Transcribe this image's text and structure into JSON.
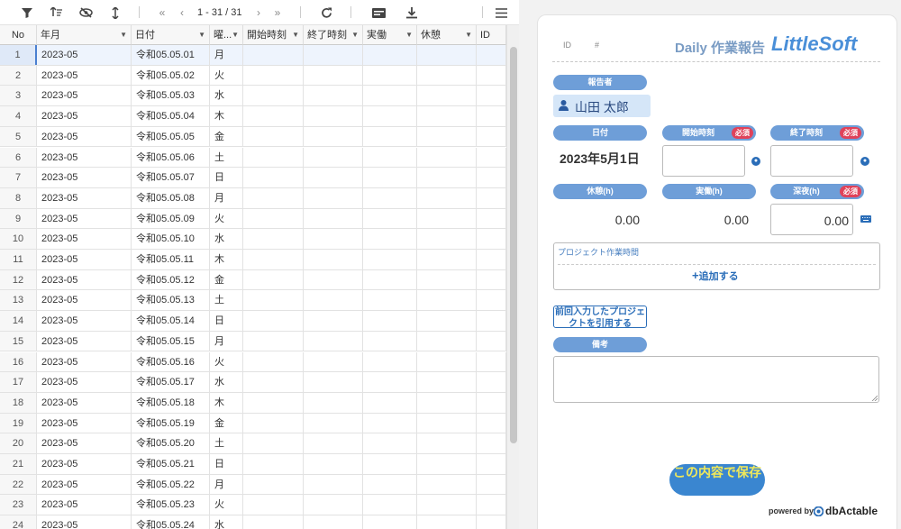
{
  "toolbar": {
    "page_indicator": "1 - 31 / 31"
  },
  "grid": {
    "columns": [
      "No",
      "年月",
      "日付",
      "曜...",
      "開始時刻",
      "終了時刻",
      "実働",
      "休憩",
      "ID"
    ],
    "rows": [
      [
        "1",
        "2023-05",
        "令和05.05.01",
        "月"
      ],
      [
        "2",
        "2023-05",
        "令和05.05.02",
        "火"
      ],
      [
        "3",
        "2023-05",
        "令和05.05.03",
        "水"
      ],
      [
        "4",
        "2023-05",
        "令和05.05.04",
        "木"
      ],
      [
        "5",
        "2023-05",
        "令和05.05.05",
        "金"
      ],
      [
        "6",
        "2023-05",
        "令和05.05.06",
        "土"
      ],
      [
        "7",
        "2023-05",
        "令和05.05.07",
        "日"
      ],
      [
        "8",
        "2023-05",
        "令和05.05.08",
        "月"
      ],
      [
        "9",
        "2023-05",
        "令和05.05.09",
        "火"
      ],
      [
        "10",
        "2023-05",
        "令和05.05.10",
        "水"
      ],
      [
        "11",
        "2023-05",
        "令和05.05.11",
        "木"
      ],
      [
        "12",
        "2023-05",
        "令和05.05.12",
        "金"
      ],
      [
        "13",
        "2023-05",
        "令和05.05.13",
        "土"
      ],
      [
        "14",
        "2023-05",
        "令和05.05.14",
        "日"
      ],
      [
        "15",
        "2023-05",
        "令和05.05.15",
        "月"
      ],
      [
        "16",
        "2023-05",
        "令和05.05.16",
        "火"
      ],
      [
        "17",
        "2023-05",
        "令和05.05.17",
        "水"
      ],
      [
        "18",
        "2023-05",
        "令和05.05.18",
        "木"
      ],
      [
        "19",
        "2023-05",
        "令和05.05.19",
        "金"
      ],
      [
        "20",
        "2023-05",
        "令和05.05.20",
        "土"
      ],
      [
        "21",
        "2023-05",
        "令和05.05.21",
        "日"
      ],
      [
        "22",
        "2023-05",
        "令和05.05.22",
        "月"
      ],
      [
        "23",
        "2023-05",
        "令和05.05.23",
        "火"
      ],
      [
        "24",
        "2023-05",
        "令和05.05.24",
        "水"
      ]
    ]
  },
  "form": {
    "id_label": "ID",
    "id_value": "#",
    "title": "Daily 作業報告",
    "brand": "LittleSoft",
    "reporter_label": "報告者",
    "reporter_name": "山田 太郎",
    "date_label": "日付",
    "date_value": "2023年5月1日",
    "start_label": "開始時刻",
    "end_label": "終了時刻",
    "required_badge": "必須",
    "break_label": "休憩(h)",
    "break_value": "0.00",
    "work_label": "実働(h)",
    "work_value": "0.00",
    "night_label": "深夜(h)",
    "night_value": "0.00",
    "project_section_label": "プロジェクト作業時間",
    "add_label": "追加する",
    "quote_button": "前回入力したプロジェクトを引用する",
    "notes_label": "備考",
    "save_button": "この内容で保存",
    "powered_by": "powered by",
    "powered_brand": "dbActable"
  }
}
